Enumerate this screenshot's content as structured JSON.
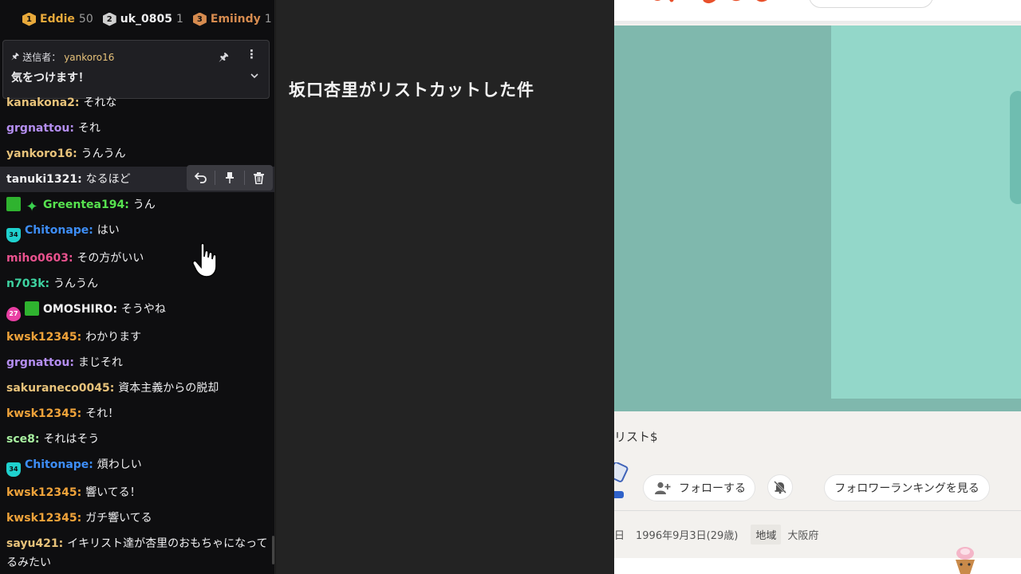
{
  "leaderboard": [
    {
      "rank": "1",
      "name": "Eddie",
      "count": "50",
      "color": "#e8a93b"
    },
    {
      "rank": "2",
      "name": "uk_0805",
      "count": "1",
      "color": "#cfcfcf"
    },
    {
      "rank": "3",
      "name": "Emiindy",
      "count": "1",
      "color": "#d68b4f"
    }
  ],
  "pinned": {
    "label": "送信者：",
    "user": "yankoro16",
    "message": "気をつけます！"
  },
  "messages": [
    {
      "user": "kanakona2",
      "color": "#e7c27a",
      "text": "それな",
      "badges": []
    },
    {
      "user": "grgnattou",
      "color": "#b48ef0",
      "text": "それ",
      "badges": []
    },
    {
      "user": "yankoro16",
      "color": "#e7c27a",
      "text": "うんうん",
      "badges": []
    },
    {
      "user": "tanuki1321",
      "color": "#efeff1",
      "text": "なるほど",
      "badges": []
    },
    {
      "user": "Greentea194",
      "color": "#57e34f",
      "text": "うん",
      "badges": [
        "gift",
        "sparkle"
      ]
    },
    {
      "user": "Chitonape",
      "color": "#3d8df5",
      "text": "はい",
      "badges": [
        "sub34"
      ]
    },
    {
      "user": "miho0603",
      "color": "#e8528e",
      "text": "その方がいい",
      "badges": []
    },
    {
      "user": "n703k",
      "color": "#3ed3a1",
      "text": "うんうん",
      "badges": []
    },
    {
      "user": "OMOSHIRO",
      "color": "#efeff1",
      "text": "そうやね",
      "badges": [
        "pink27",
        "gift"
      ]
    },
    {
      "user": "kwsk12345",
      "color": "#f0a33a",
      "text": "わかります",
      "badges": []
    },
    {
      "user": "grgnattou",
      "color": "#b48ef0",
      "text": "まじそれ",
      "badges": []
    },
    {
      "user": "sakuraneco0045",
      "color": "#e7c27a",
      "text": "資本主義からの脱却",
      "badges": []
    },
    {
      "user": "kwsk12345",
      "color": "#f0a33a",
      "text": "それ！",
      "badges": []
    },
    {
      "user": "sce8",
      "color": "#a8f0a0",
      "text": "それはそう",
      "badges": []
    },
    {
      "user": "Chitonape",
      "color": "#3d8df5",
      "text": "煩わしい",
      "badges": [
        "sub34"
      ]
    },
    {
      "user": "kwsk12345",
      "color": "#f0a33a",
      "text": "響いてる！",
      "badges": []
    },
    {
      "user": "kwsk12345",
      "color": "#f0a33a",
      "text": "ガチ響いてる",
      "badges": []
    },
    {
      "user": "sayu421",
      "color": "#e7c27a",
      "text": "イキリスト達が杏里のおもちゃになってるみたい",
      "badges": []
    }
  ],
  "badge_labels": {
    "sub34": "34",
    "pink27": "27"
  },
  "video": {
    "title": "坂口杏里がリストカットした件"
  },
  "profile": {
    "name_fragment": "リスト$",
    "follow_label": "フォローする",
    "ranking_label": "フォロワーランキングを見る",
    "birth_label_fragment": "日",
    "birth_value": "1996年9月3日(29歳)",
    "region_label": "地域",
    "region_value": "大阪府"
  },
  "icons": {
    "pin": "pin-icon",
    "more": "more-vertical-icon",
    "expand": "chevron-down-icon",
    "reply": "reply-icon",
    "delete": "trash-icon",
    "follow": "add-user-icon",
    "mute": "mute-bell-icon"
  }
}
